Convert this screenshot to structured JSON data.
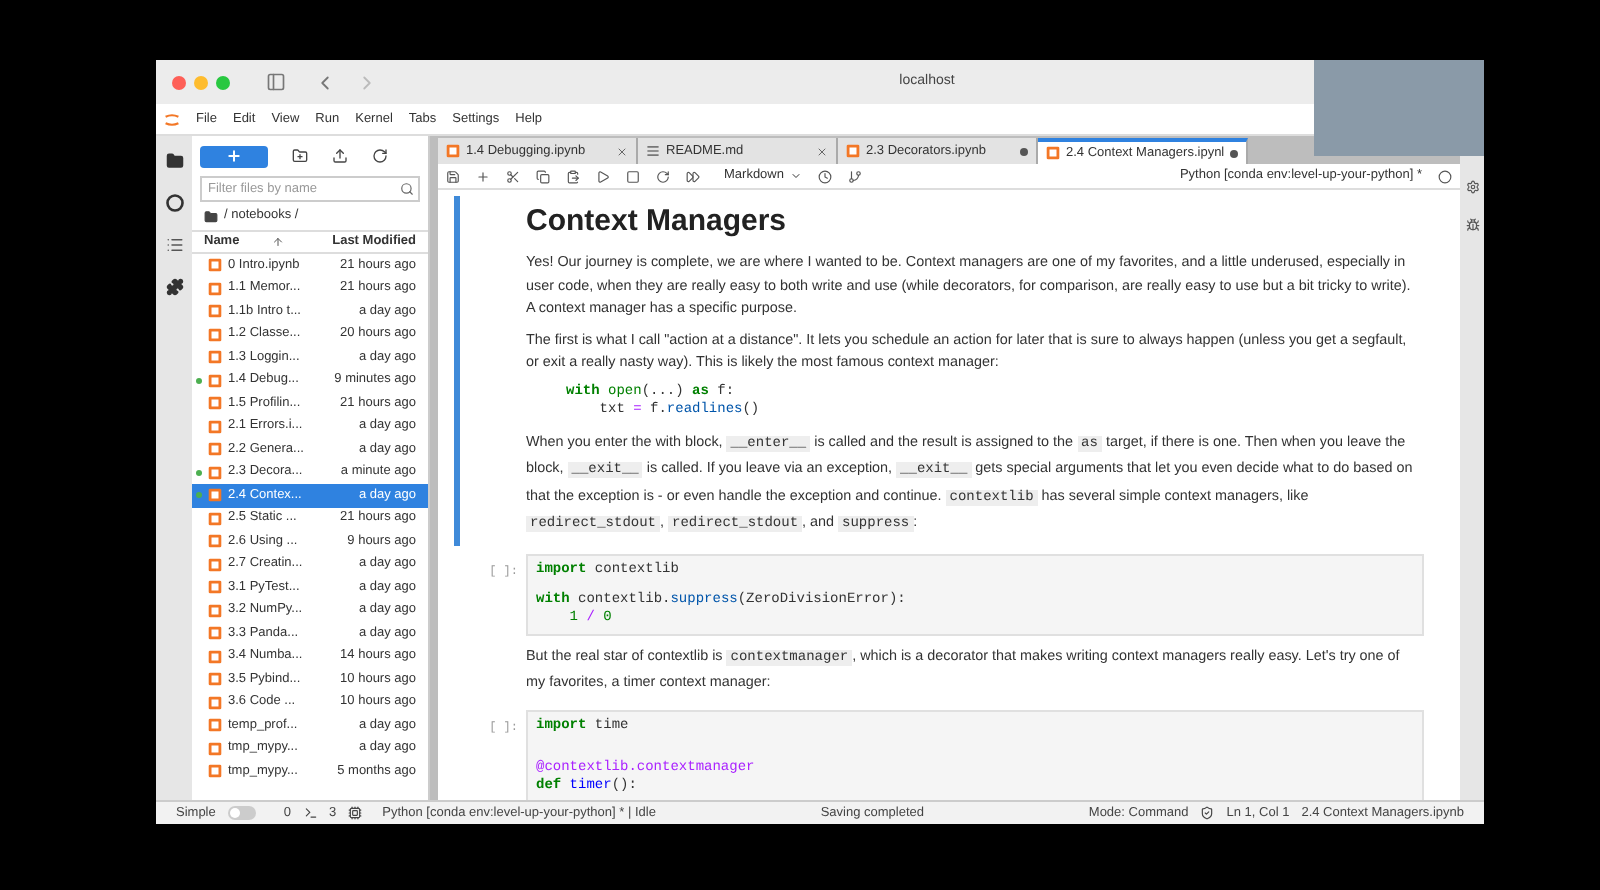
{
  "browser": {
    "address": "localhost"
  },
  "menu": [
    "File",
    "Edit",
    "View",
    "Run",
    "Kernel",
    "Tabs",
    "Settings",
    "Help"
  ],
  "file_browser": {
    "filter_placeholder": "Filter files by name",
    "path": "/ notebooks /",
    "columns": [
      "Name",
      "Last Modified"
    ],
    "files": [
      {
        "name": "0 Intro.ipynb",
        "modified": "21 hours ago",
        "running": false,
        "selected": false
      },
      {
        "name": "1.1 Memor...",
        "modified": "21 hours ago",
        "running": false,
        "selected": false
      },
      {
        "name": "1.1b Intro t...",
        "modified": "a day ago",
        "running": false,
        "selected": false
      },
      {
        "name": "1.2 Classe...",
        "modified": "20 hours ago",
        "running": false,
        "selected": false
      },
      {
        "name": "1.3 Loggin...",
        "modified": "a day ago",
        "running": false,
        "selected": false
      },
      {
        "name": "1.4 Debug...",
        "modified": "9 minutes ago",
        "running": true,
        "selected": false
      },
      {
        "name": "1.5 Profilin...",
        "modified": "21 hours ago",
        "running": false,
        "selected": false
      },
      {
        "name": "2.1 Errors.i...",
        "modified": "a day ago",
        "running": false,
        "selected": false
      },
      {
        "name": "2.2 Genera...",
        "modified": "a day ago",
        "running": false,
        "selected": false
      },
      {
        "name": "2.3 Decora...",
        "modified": "a minute ago",
        "running": true,
        "selected": false
      },
      {
        "name": "2.4 Contex...",
        "modified": "a day ago",
        "running": true,
        "selected": true
      },
      {
        "name": "2.5 Static ...",
        "modified": "21 hours ago",
        "running": false,
        "selected": false
      },
      {
        "name": "2.6 Using ...",
        "modified": "9 hours ago",
        "running": false,
        "selected": false
      },
      {
        "name": "2.7 Creatin...",
        "modified": "a day ago",
        "running": false,
        "selected": false
      },
      {
        "name": "3.1 PyTest...",
        "modified": "a day ago",
        "running": false,
        "selected": false
      },
      {
        "name": "3.2 NumPy...",
        "modified": "a day ago",
        "running": false,
        "selected": false
      },
      {
        "name": "3.3 Panda...",
        "modified": "a day ago",
        "running": false,
        "selected": false
      },
      {
        "name": "3.4 Numba...",
        "modified": "14 hours ago",
        "running": false,
        "selected": false
      },
      {
        "name": "3.5 Pybind...",
        "modified": "10 hours ago",
        "running": false,
        "selected": false
      },
      {
        "name": "3.6 Code ...",
        "modified": "10 hours ago",
        "running": false,
        "selected": false
      },
      {
        "name": "temp_prof...",
        "modified": "a day ago",
        "running": false,
        "selected": false
      },
      {
        "name": "tmp_mypy...",
        "modified": "a day ago",
        "running": false,
        "selected": false
      },
      {
        "name": "tmp_mypy...",
        "modified": "5 months ago",
        "running": false,
        "selected": false
      }
    ]
  },
  "tabs": [
    {
      "label": "1.4 Debugging.ipynb",
      "kind": "notebook",
      "dirty": false,
      "selected": false
    },
    {
      "label": "README.md",
      "kind": "markdown",
      "dirty": false,
      "selected": false
    },
    {
      "label": "2.3 Decorators.ipynb",
      "kind": "notebook",
      "dirty": true,
      "selected": false
    },
    {
      "label": "2.4 Context Managers.ipynl",
      "kind": "notebook",
      "dirty": true,
      "selected": true
    }
  ],
  "toolbar": {
    "cell_type": "Markdown",
    "kernel": "Python [conda env:level-up-your-python] *"
  },
  "cells": [
    {
      "kind": "markdown",
      "selected": true,
      "blocks": [
        {
          "kind": "heading",
          "text": "Context Managers"
        },
        {
          "kind": "paragraph",
          "segments": [
            {
              "kind": "text",
              "text": "Yes! Our journey is complete, we are where I wanted to be. Context managers are one of my favorites, and a little underused, especially in user code, when they are really easy to both write and use (while decorators, for comparison, are really easy to use but a bit tricky to write). A context manager has a specific purpose."
            }
          ]
        },
        {
          "kind": "paragraph",
          "segments": [
            {
              "kind": "text",
              "text": "The first is what I call \"action at a distance\". It lets you schedule an action for later that is sure to always happen (unless you get a segfault, or exit a really nasty way). This is likely the most famous context manager:"
            }
          ]
        },
        {
          "kind": "code",
          "lines": [
            {
              "kind": "code",
              "tokens": [
                {
                  "kind": "kw",
                  "text": "with"
                },
                {
                  "kind": "builtin",
                  "text": " open"
                },
                {
                  "kind": "plain",
                  "text": "(...) "
                },
                {
                  "kind": "kw",
                  "text": "as"
                },
                {
                  "kind": "plain",
                  "text": " f:"
                }
              ]
            },
            {
              "kind": "code",
              "tokens": [
                {
                  "kind": "plain",
                  "text": "    txt "
                },
                {
                  "kind": "op",
                  "text": "="
                },
                {
                  "kind": "plain",
                  "text": " f."
                },
                {
                  "kind": "attr",
                  "text": "readlines"
                },
                {
                  "kind": "plain",
                  "text": "()"
                }
              ]
            }
          ]
        },
        {
          "kind": "paragraph",
          "segments": [
            {
              "kind": "text",
              "text": "When you enter the with block, "
            },
            {
              "kind": "code",
              "text": "__enter__"
            },
            {
              "kind": "text",
              "text": " is called and the result is assigned to the "
            },
            {
              "kind": "code",
              "text": "as"
            },
            {
              "kind": "text",
              "text": " target, if there is one. Then when you leave the block, "
            },
            {
              "kind": "code",
              "text": "__exit__"
            },
            {
              "kind": "text",
              "text": " is called. If you leave via an exception, "
            },
            {
              "kind": "code",
              "text": "__exit__"
            },
            {
              "kind": "text",
              "text": " gets special arguments that let you even decide what to do based on that the exception is - or even handle the exception and continue. "
            },
            {
              "kind": "code",
              "text": "contextlib"
            },
            {
              "kind": "text",
              "text": " has several simple context managers, like "
            },
            {
              "kind": "code",
              "text": "redirect_stdout"
            },
            {
              "kind": "text",
              "text": ", "
            },
            {
              "kind": "code",
              "text": "redirect_stdout"
            },
            {
              "kind": "text",
              "text": ", and "
            },
            {
              "kind": "code",
              "text": "suppress"
            },
            {
              "kind": "text",
              "text": ":"
            }
          ]
        }
      ]
    },
    {
      "kind": "code",
      "prompt": "[ ]:",
      "lines": [
        {
          "kind": "code",
          "tokens": [
            {
              "kind": "kw",
              "text": "import"
            },
            {
              "kind": "plain",
              "text": " contextlib"
            }
          ]
        },
        {
          "kind": "blank"
        },
        {
          "kind": "code",
          "tokens": [
            {
              "kind": "kw",
              "text": "with"
            },
            {
              "kind": "plain",
              "text": " contextlib."
            },
            {
              "kind": "attr",
              "text": "suppress"
            },
            {
              "kind": "plain",
              "text": "(ZeroDivisionError):"
            }
          ]
        },
        {
          "kind": "code",
          "tokens": [
            {
              "kind": "num",
              "text": "    1"
            },
            {
              "kind": "op",
              "text": " /"
            },
            {
              "kind": "num",
              "text": " 0"
            }
          ]
        }
      ]
    },
    {
      "kind": "markdown",
      "selected": false,
      "blocks": [
        {
          "kind": "paragraph",
          "segments": [
            {
              "kind": "text",
              "text": "But the real star of contextlib is "
            },
            {
              "kind": "code",
              "text": "contextmanager"
            },
            {
              "kind": "text",
              "text": ", which is a decorator that makes writing context managers really easy. Let's try one of my favorites, a timer context manager:"
            }
          ]
        }
      ]
    },
    {
      "kind": "code",
      "prompt": "[ ]:",
      "lines": [
        {
          "kind": "code",
          "tokens": [
            {
              "kind": "kw",
              "text": "import"
            },
            {
              "kind": "plain",
              "text": " time"
            }
          ]
        },
        {
          "kind": "blank"
        },
        {
          "kind": "blank"
        },
        {
          "kind": "code",
          "tokens": [
            {
              "kind": "deco",
              "text": "@contextlib.contextmanager"
            }
          ]
        },
        {
          "kind": "code",
          "tokens": [
            {
              "kind": "kw",
              "text": "def"
            },
            {
              "kind": "func",
              "text": " timer"
            },
            {
              "kind": "plain",
              "text": "():"
            }
          ]
        }
      ]
    }
  ],
  "status_bar": {
    "simple_label": "Simple",
    "simple_on": false,
    "terminals": "0",
    "kernels": "3",
    "kernel_status": "Python [conda env:level-up-your-python] * | Idle",
    "message": "Saving completed",
    "mode": "Mode: Command",
    "position": "Ln 1, Col 1",
    "file": "2.4 Context Managers.ipynb"
  }
}
